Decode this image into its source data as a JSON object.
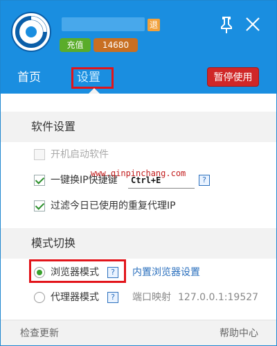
{
  "header": {
    "logout_label": "退",
    "recharge_label": "充值",
    "points": "14680",
    "pause_label": "暂停使用"
  },
  "tabs": {
    "home": "首页",
    "settings": "设置"
  },
  "software_settings": {
    "title": "软件设置",
    "autostart_label": "开机启动软件",
    "hotkey_label": "一键换IP快捷键",
    "hotkey_value": "Ctrl+E",
    "filter_label": "过滤今日已使用的重复代理IP"
  },
  "watermark": "www.qinpinchang.com",
  "mode_switch": {
    "title": "模式切换",
    "browser_mode_label": "浏览器模式",
    "browser_settings_link": "内置浏览器设置",
    "proxy_mode_label": "代理器模式",
    "port_mapping_label": "端口映射",
    "port_mapping_value": "127.0.0.1:19527"
  },
  "help_glyph": "?",
  "footer": {
    "check_update": "检查更新",
    "help_center": "帮助中心"
  },
  "colors": {
    "header_bg": "#1a8ee0",
    "accent_red": "#d02727",
    "check_green": "#2a8f2a",
    "link_blue": "#2a6fbd"
  }
}
